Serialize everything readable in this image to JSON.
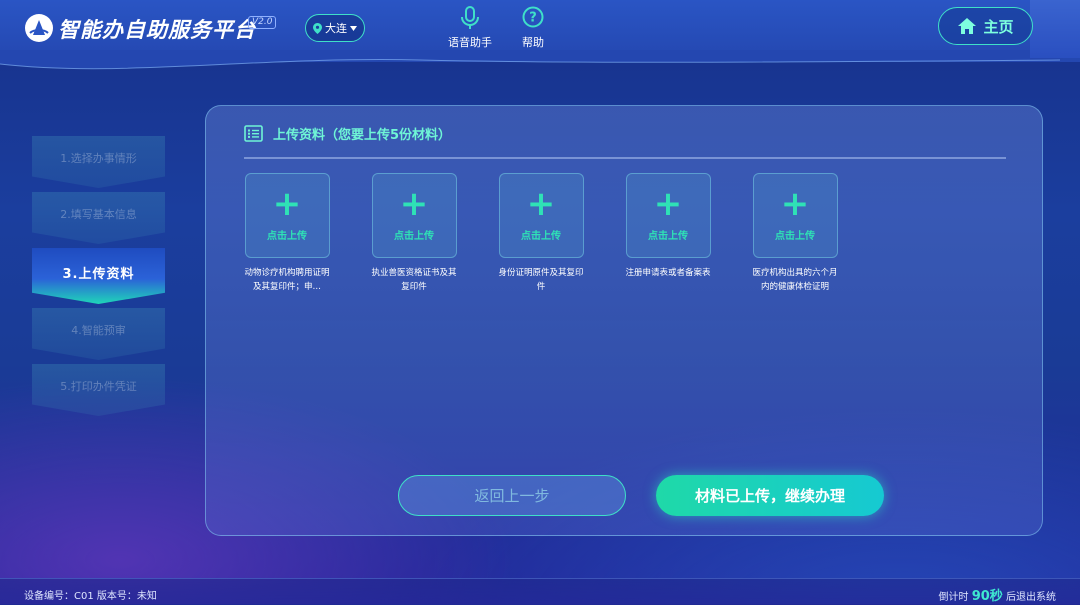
{
  "header": {
    "app_title": "智能办自助服务平台",
    "version": "V2.0",
    "city": "大连",
    "voice_label": "语音助手",
    "help_label": "帮助",
    "home_label": "主页"
  },
  "steps": [
    {
      "label": "1.选择办事情形"
    },
    {
      "label": "2.填写基本信息"
    },
    {
      "label": "3.上传资料"
    },
    {
      "label": "4.智能预审"
    },
    {
      "label": "5.打印办件凭证"
    }
  ],
  "upload": {
    "title": "上传资料（您要上传5份材料）",
    "card_action": "点击上传",
    "documents": [
      {
        "label": "动物诊疗机构聘用证明及其复印件；申…"
      },
      {
        "label": "执业兽医资格证书及其复印件"
      },
      {
        "label": "身份证明原件及其复印件"
      },
      {
        "label": "注册申请表或者备案表"
      },
      {
        "label": "医疗机构出具的六个月内的健康体检证明"
      }
    ]
  },
  "actions": {
    "back_label": "返回上一步",
    "next_label": "材料已上传，继续办理"
  },
  "footer": {
    "device": "设备编号：C01 版本号：未知",
    "countdown_prefix": "倒计时",
    "countdown_value": "90秒",
    "countdown_suffix": "后退出系统"
  },
  "colors": {
    "accent": "#2fe2b6",
    "primary_bg": "#1b3e9e"
  }
}
